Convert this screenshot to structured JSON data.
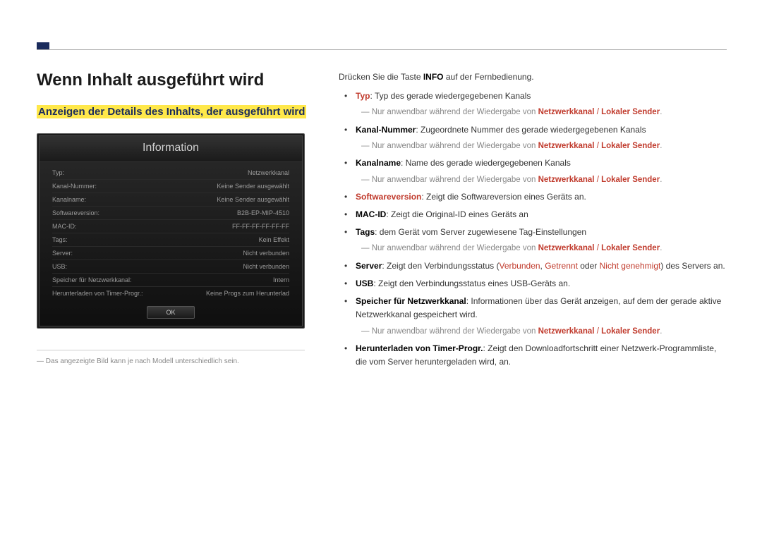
{
  "heading": "Wenn Inhalt ausgeführt wird",
  "subheading": "Anzeigen der Details des Inhalts, der ausgeführt wird",
  "panel": {
    "title": "Information",
    "rows": [
      {
        "label": "Typ:",
        "value": "Netzwerkkanal"
      },
      {
        "label": "Kanal-Nummer:",
        "value": "Keine Sender ausgewählt"
      },
      {
        "label": "Kanalname:",
        "value": "Keine Sender ausgewählt"
      },
      {
        "label": "Softwareversion:",
        "value": "B2B-EP-MIP-4510"
      },
      {
        "label": "MAC-ID:",
        "value": "FF-FF-FF-FF-FF-FF"
      },
      {
        "label": "Tags:",
        "value": "Kein Effekt"
      },
      {
        "label": "Server:",
        "value": "Nicht verbunden"
      },
      {
        "label": "USB:",
        "value": "Nicht verbunden"
      },
      {
        "label": "Speicher für Netzwerkkanal:",
        "value": "Intern"
      },
      {
        "label": "Herunterladen von Timer-Progr.:",
        "value": "Keine Progs zum Herunterlad"
      }
    ],
    "ok": "OK"
  },
  "footnote": "Das angezeigte Bild kann je nach Modell unterschiedlich sein.",
  "intro": {
    "prefix": "Drücken Sie die Taste ",
    "key": "INFO",
    "suffix": " auf der Fernbedienung."
  },
  "note": {
    "prefix": "Nur anwendbar während der Wiedergabe von ",
    "a": "Netzwerkkanal",
    "sep": " / ",
    "b": "Lokaler Sender",
    "end": "."
  },
  "items": {
    "typ": {
      "term": "Typ",
      "desc": ": Typ des gerade wiedergegebenen Kanals"
    },
    "kanalnummer": {
      "term": "Kanal-Nummer",
      "desc": ": Zugeordnete Nummer des gerade wiedergegebenen Kanals"
    },
    "kanalname": {
      "term": "Kanalname",
      "desc": ": Name des gerade wiedergegebenen Kanals"
    },
    "software": {
      "term": "Softwareversion",
      "desc": ": Zeigt die Softwareversion eines Geräts an."
    },
    "macid": {
      "term": "MAC-ID",
      "desc": ": Zeigt die Original-ID eines Geräts an"
    },
    "tags": {
      "term": "Tags",
      "desc": ": dem Gerät vom Server zugewiesene Tag-Einstellungen"
    },
    "server": {
      "term": "Server",
      "p1": ": Zeigt den Verbindungsstatus (",
      "s1": "Verbunden",
      "c1": ", ",
      "s2": "Getrennt",
      "c2": " oder ",
      "s3": "Nicht genehmigt",
      "p2": ") des Servers an."
    },
    "usb": {
      "term": "USB",
      "desc": ": Zeigt den Verbindungsstatus eines USB-Geräts an."
    },
    "speicher": {
      "term": "Speicher für Netzwerkkanal",
      "desc": ": Informationen über das Gerät anzeigen, auf dem der gerade aktive Netzwerkkanal gespeichert wird."
    },
    "timer": {
      "term": "Herunterladen von Timer-Progr.",
      "desc": ": Zeigt den Downloadfortschritt einer Netzwerk-Programmliste, die vom Server heruntergeladen wird, an."
    }
  }
}
